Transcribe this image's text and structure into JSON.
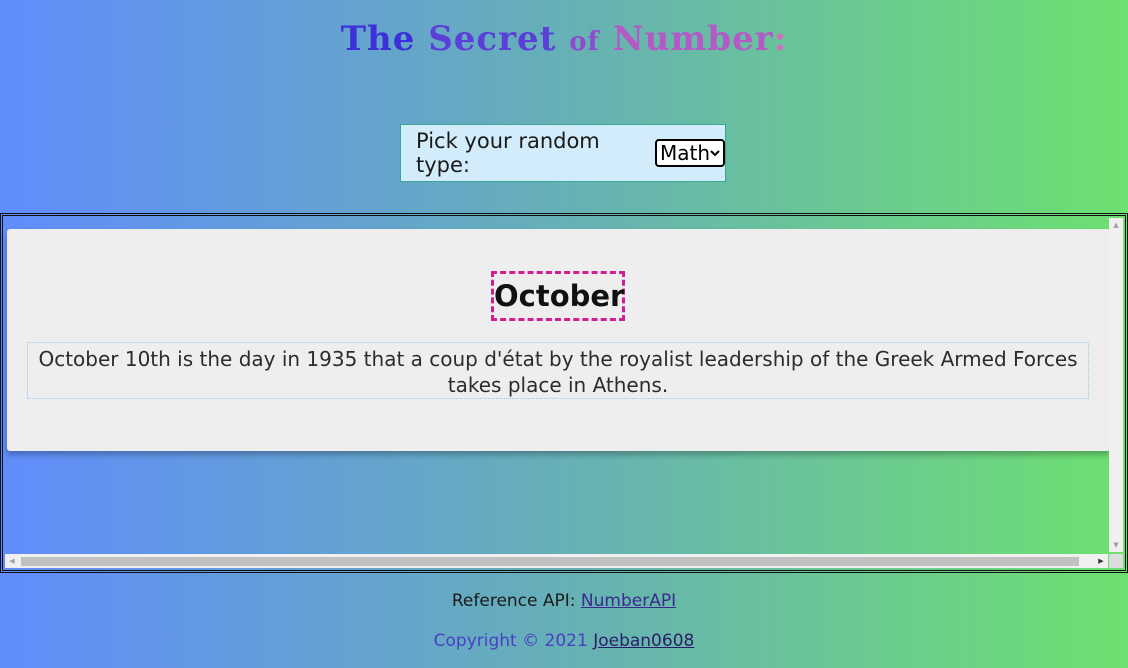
{
  "header": {
    "title_the": "The",
    "title_secret": "Secret",
    "title_of": "of",
    "title_number": "Number",
    "title_colon": ":"
  },
  "picker": {
    "label": "Pick your random type:",
    "selected": "Math"
  },
  "result": {
    "month": "October",
    "fact": "October 10th is the day in 1935 that a coup d'état by the royalist leadership of the Greek Armed Forces takes place in Athens."
  },
  "footer": {
    "reference_prefix": "Reference API:",
    "reference_link": "NumberAPI",
    "copyright_prefix": "Copyright © 2021",
    "copyright_link": "Joeban0608"
  },
  "icons": {
    "select": "chevron-down-icon",
    "scroll_up": "triangle-up-icon",
    "scroll_down": "triangle-down-icon",
    "scroll_left": "triangle-left-icon",
    "scroll_right": "triangle-right-icon"
  },
  "colors": {
    "gradient_left": "#618cfc",
    "gradient_right": "#6ee070",
    "picker_bg": "#d3ecfb",
    "month_border": "#d01d94"
  }
}
